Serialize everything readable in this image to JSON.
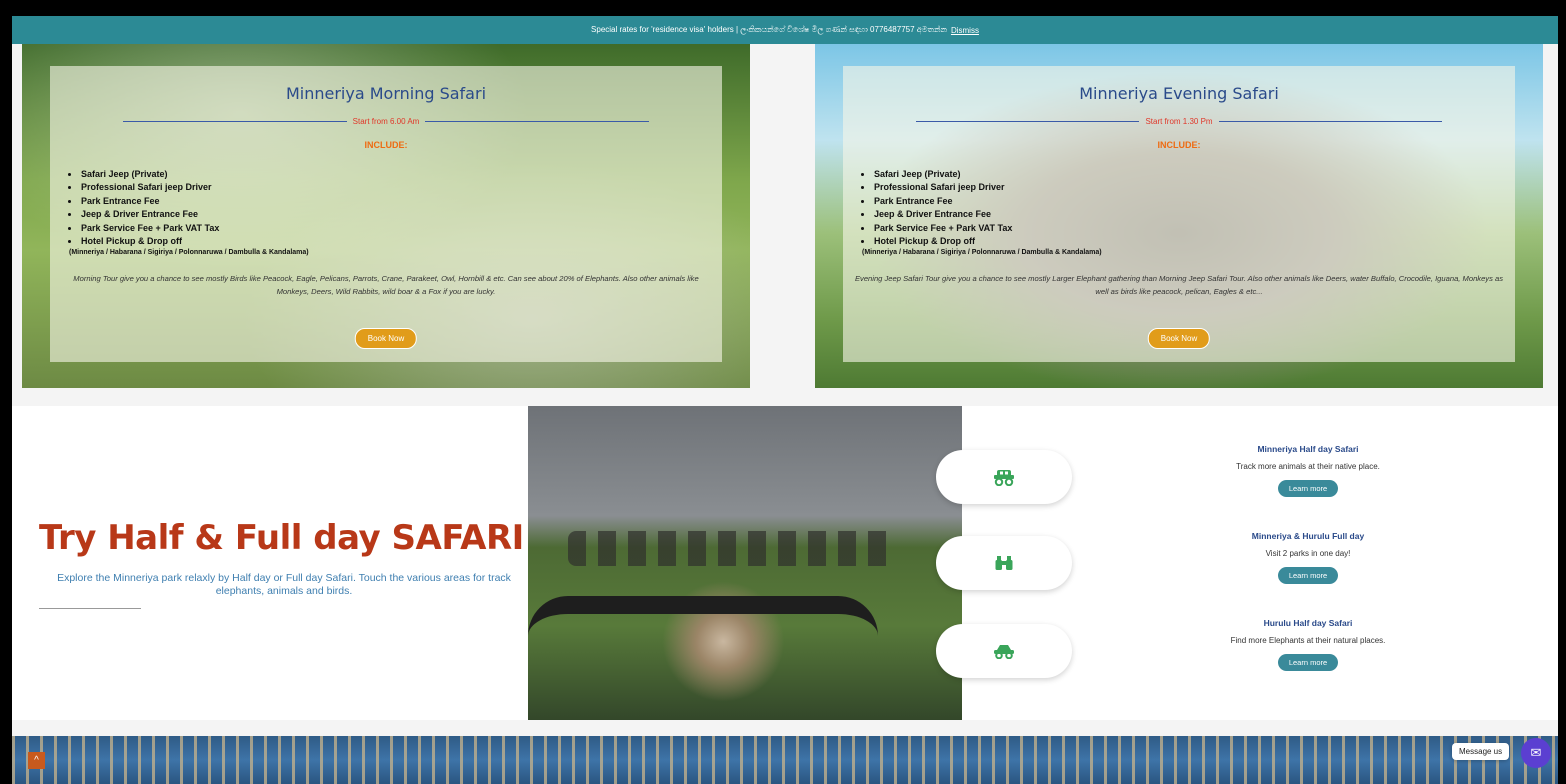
{
  "notice": {
    "text": "Special rates for 'residence visa' holders | ලංකිකයන්ගේ විශේෂ මිල ගණන් සඳහා 0776487757 අමතන්න",
    "dismiss": "Dismiss"
  },
  "cards": [
    {
      "title": "Minneriya Morning Safari",
      "start": "Start from 6.00 Am",
      "include_label": "INCLUDE:",
      "items": [
        "Safari Jeep (Private)",
        "Professional Safari jeep Driver",
        "Park Entrance Fee",
        "Jeep & Driver Entrance Fee",
        "Park Service Fee + Park VAT Tax",
        "Hotel Pickup & Drop off"
      ],
      "hotel_cities": "(Minneriya / Habarana / Sigiriya / Polonnaruwa / Dambulla & Kandalama)",
      "description": "Morning Tour give you a chance to see mostly Birds like Peacock, Eagle, Pelicans, Parrots, Crane, Parakeet, Owl, Hornbill & etc. Can see about 20% of Elephants. Also other animals like Monkeys, Deers, Wild Rabbits, wild boar & a Fox if you are lucky.",
      "button": "Book Now"
    },
    {
      "title": "Minneriya Evening Safari",
      "start": "Start from 1.30 Pm",
      "include_label": "INCLUDE:",
      "items": [
        "Safari Jeep (Private)",
        "Professional Safari jeep Driver",
        "Park Entrance Fee",
        "Jeep & Driver Entrance Fee",
        "Park Service Fee + Park VAT Tax",
        "Hotel Pickup & Drop off"
      ],
      "hotel_cities": "(Minneriya / Habarana / Sigiriya / Polonnaruwa / Dambulla & Kandalama)",
      "description": "Evening Jeep Safari Tour give you a chance to see mostly Larger Elephant gathering than Morning Jeep Safari Tour. Also other animals like Deers, water Buffalo, Crocodile, Iguana, Monkeys as well as birds like peacock, pelican, Eagles & etc...",
      "button": "Book Now"
    }
  ],
  "try": {
    "heading": "Try Half & Full day SAFARI",
    "description": "Explore the Minneriya park relaxly by Half day or Full day Safari. Touch the various areas for track elephants, animals and birds."
  },
  "icons": [
    "jeep-icon",
    "binoculars-icon",
    "car-icon"
  ],
  "offers": [
    {
      "title": "Minneriya Half day Safari",
      "subtitle": "Track more animals at their native place.",
      "button": "Learn more"
    },
    {
      "title": "Minneriya & Hurulu Full day",
      "subtitle": "Visit 2 parks in one day!",
      "button": "Learn more"
    },
    {
      "title": "Hurulu Half day Safari",
      "subtitle": "Find more Elephants at their natural places.",
      "button": "Learn more"
    }
  ],
  "widgets": {
    "message_us": "Message us",
    "scroll_top_glyph": "^",
    "chat_glyph": "✉"
  },
  "colors": {
    "notice_bg": "#2c8a95",
    "title_blue": "#2a4a8a",
    "include_orange": "#ee6b12",
    "book_button": "#e19c1a",
    "heading_red": "#b83818",
    "learn_button": "#3a8a9a"
  }
}
